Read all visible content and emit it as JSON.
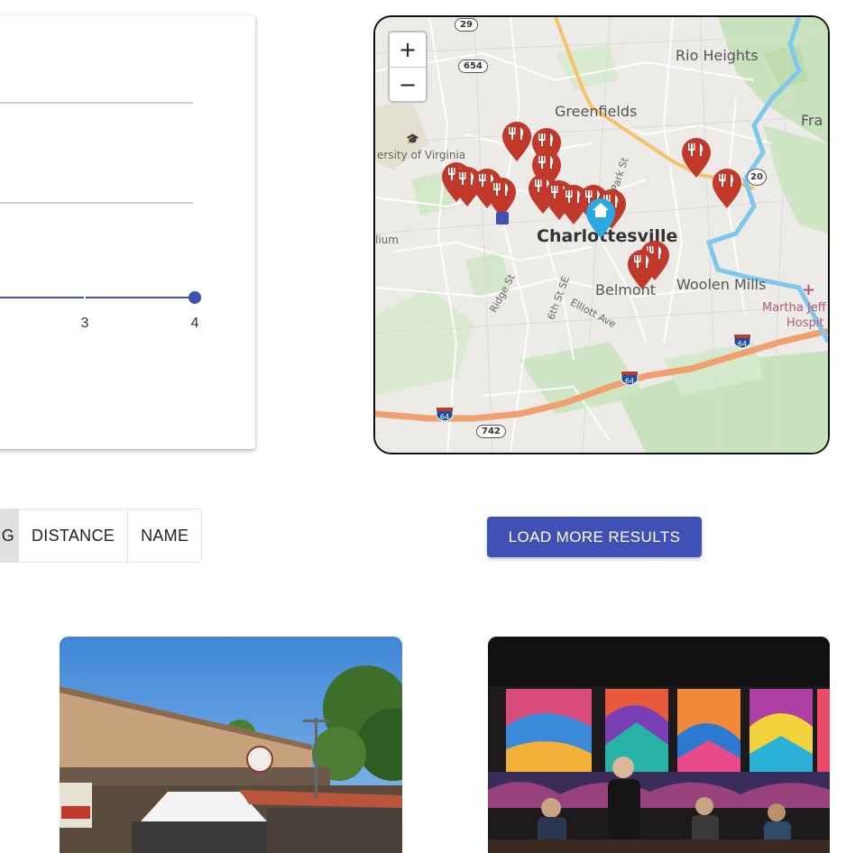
{
  "chart_data": {
    "type": "line",
    "x_ticks": [
      "3",
      "4"
    ],
    "visible_point": {
      "x": 4
    },
    "grid": true
  },
  "map": {
    "zoom_in_label": "+",
    "zoom_out_label": "−",
    "labels": {
      "rio_heights": "Rio Heights",
      "greenfields": "Greenfields",
      "university": "ersity of Virginia",
      "charlottesville": "Charlottesville",
      "belmont": "Belmont",
      "woolen_mills": "Woolen Mills",
      "fra": "Fra",
      "martha": "Martha Jeff",
      "hospital": "Hospit",
      "lium": "lium",
      "ridge_st": "Ridge St",
      "sixth_st": "6th St SE",
      "elliott": "Elliott Ave",
      "park_st": "Park St"
    },
    "shields": {
      "r29": "29",
      "r654": "654",
      "r20": "20",
      "r742": "742",
      "i64_a": "64",
      "i64_b": "64",
      "i64_c": "64"
    },
    "marker_color": "#c0392b",
    "home_marker_color": "#29a9e0"
  },
  "sort": {
    "active_partial": "G",
    "distance": "DISTANCE",
    "name": "NAME"
  },
  "load_more_label": "LOAD MORE RESULTS",
  "colors": {
    "accent": "#3f51b5",
    "marker": "#c0392b"
  }
}
